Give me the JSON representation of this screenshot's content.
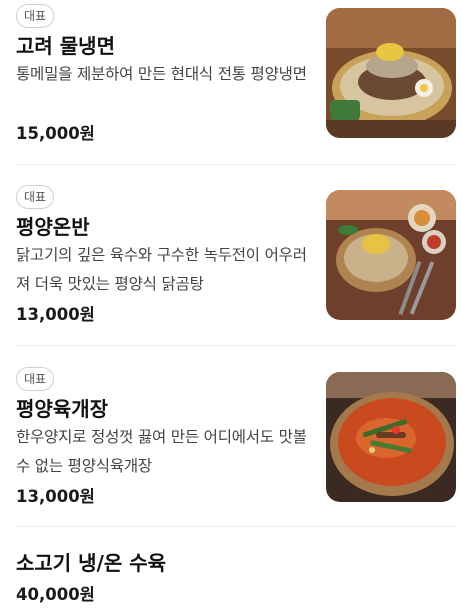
{
  "menu": [
    {
      "badge": "대표",
      "name": "고려 물냉면",
      "description": "통메밀을 제분하여 만든 현대식 전통 평양냉면",
      "price": "15,000원",
      "image": "cold-noodle-photo"
    },
    {
      "badge": "대표",
      "name": "평양온반",
      "description": "닭고기의 깊은 육수와 구수한 녹두전이 어우러져 더욱 맛있는 평양식 닭곰탕",
      "price": "13,000원",
      "image": "chicken-rice-soup-photo"
    },
    {
      "badge": "대표",
      "name": "평양육개장",
      "description": "한우양지로 정성껏 끓여 만든 어디에서도 맛볼수 없는 평양식육개장",
      "price": "13,000원",
      "image": "spicy-beef-soup-photo"
    },
    {
      "name": "소고기 냉/온 수육",
      "price": "40,000원"
    }
  ]
}
